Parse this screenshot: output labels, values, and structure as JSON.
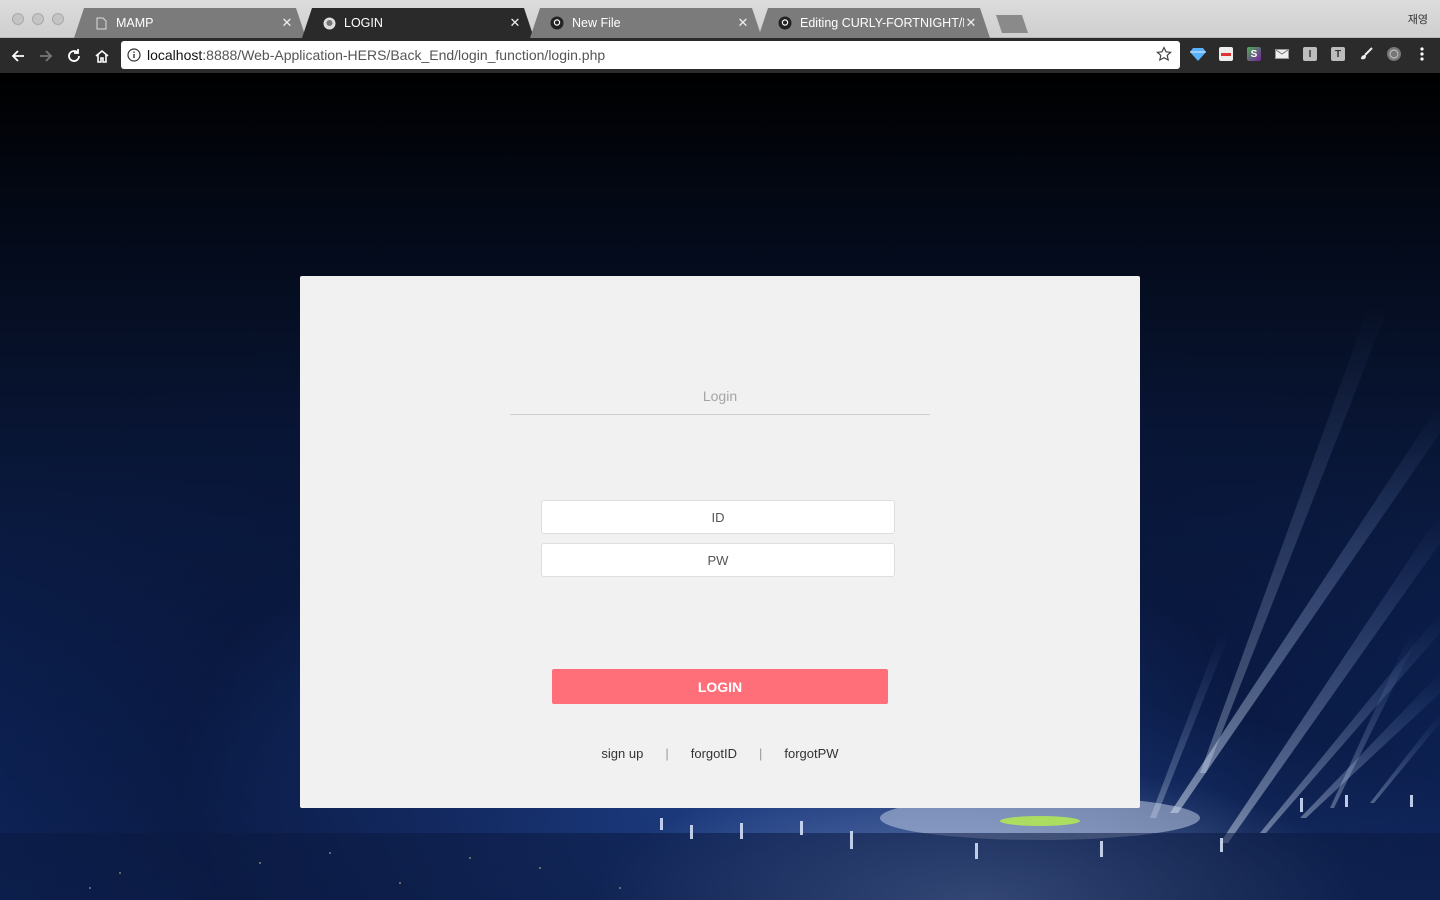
{
  "browser": {
    "profile_name": "재영",
    "tabs": [
      {
        "title": "MAMP",
        "icon": "page-icon",
        "active": false
      },
      {
        "title": "LOGIN",
        "icon": "site-favicon-icon",
        "active": true
      },
      {
        "title": "New File",
        "icon": "github-icon",
        "active": false
      },
      {
        "title": "Editing CURLY-FORTNIGHT/RE",
        "icon": "github-icon",
        "active": false
      }
    ],
    "url": {
      "host": "localhost",
      "rest": ":8888/Web-Application-HERS/Back_End/login_function/login.php"
    },
    "extensions": [
      "diamond-icon",
      "calendar-icon",
      "s-icon",
      "email-icon",
      "i-icon",
      "t-icon",
      "brush-icon",
      "round-icon"
    ]
  },
  "login": {
    "title": "Login",
    "id_placeholder": "ID",
    "pw_placeholder": "PW",
    "submit_label": "LOGIN",
    "links": [
      "sign up",
      "forgotID",
      "forgotPW"
    ],
    "separator": "|"
  },
  "colors": {
    "login_button": "#ff6f7a",
    "card_background": "#f1f1f1",
    "active_tab": "#2a2a2a"
  }
}
